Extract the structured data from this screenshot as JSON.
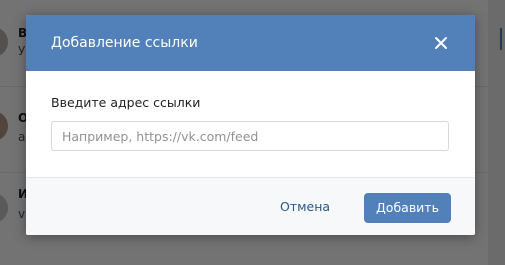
{
  "background": {
    "rows": [
      {
        "title": "В",
        "subtitle": "У"
      },
      {
        "title": "О",
        "subtitle": "а"
      },
      {
        "title": "И",
        "subtitle": "v"
      }
    ]
  },
  "dialog": {
    "title": "Добавление ссылки",
    "field_label": "Введите адрес ссылки",
    "input_placeholder": "Например, https://vk.com/feed",
    "input_value": "",
    "cancel_label": "Отмена",
    "submit_label": "Добавить"
  },
  "icons": {
    "close": "close-icon"
  },
  "colors": {
    "accent": "#5181b8",
    "link": "#2a5885",
    "footer_bg": "#f7f8fa"
  }
}
